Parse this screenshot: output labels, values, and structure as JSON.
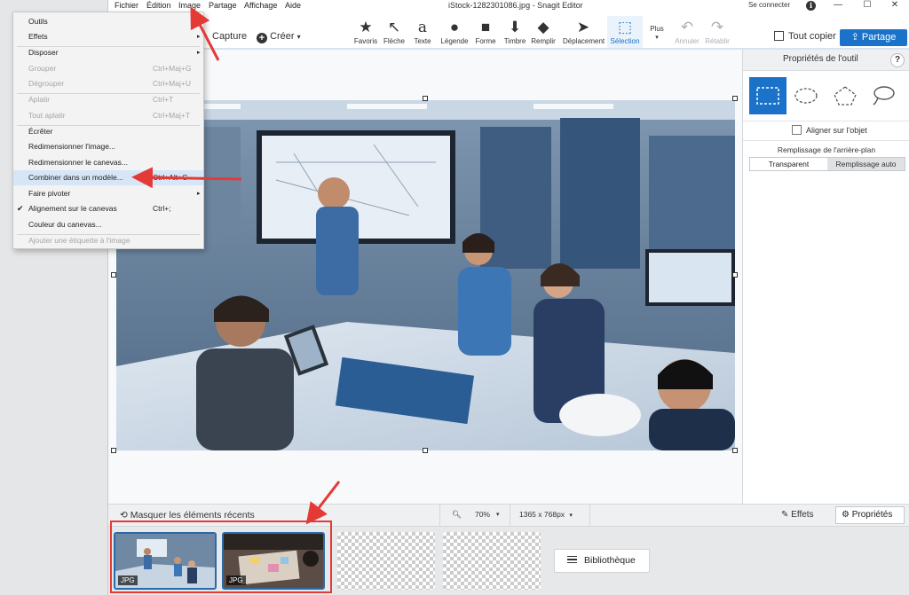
{
  "menubar": {
    "items": [
      "Fichier",
      "Édition",
      "Image",
      "Partage",
      "Affichage",
      "Aide"
    ],
    "window_title": "iStock-1282301086.jpg - Snagit Editor",
    "sign_in": "Se connecter",
    "info": "i",
    "min": "—",
    "max": "☐",
    "close": "✕"
  },
  "toolbar": {
    "capture": "Capture",
    "create": "Créer",
    "tools": [
      {
        "label": "Favoris",
        "icon": "★"
      },
      {
        "label": "Flèche",
        "icon": "↖"
      },
      {
        "label": "Texte",
        "icon": "a"
      },
      {
        "label": "Légende",
        "icon": "●"
      },
      {
        "label": "Forme",
        "icon": "■"
      },
      {
        "label": "Timbre",
        "icon": "⬇"
      },
      {
        "label": "Remplir",
        "icon": "◆"
      },
      {
        "label": "Déplacement",
        "icon": "➤"
      },
      {
        "label": "Sélection",
        "icon": "⬚"
      },
      {
        "label": "Plus",
        "icon": ""
      },
      {
        "label": "Annuler",
        "icon": "↶"
      },
      {
        "label": "Rétablir",
        "icon": "↷"
      }
    ],
    "copy_all": "Tout copier",
    "share": "Partage"
  },
  "dropdown": {
    "items": [
      {
        "label": "Outils",
        "shortcut": "",
        "disabled": false,
        "arrow": false
      },
      {
        "label": "Effets",
        "shortcut": "",
        "disabled": false,
        "arrow": true
      },
      {
        "label": "Disposer",
        "shortcut": "",
        "disabled": false,
        "arrow": true
      },
      {
        "label": "Grouper",
        "shortcut": "Ctrl+Maj+G",
        "disabled": true,
        "arrow": false
      },
      {
        "label": "Dégrouper",
        "shortcut": "Ctrl+Maj+U",
        "disabled": true,
        "arrow": false
      },
      {
        "label": "Aplatir",
        "shortcut": "Ctrl+T",
        "disabled": true,
        "arrow": false
      },
      {
        "label": "Tout aplatir",
        "shortcut": "Ctrl+Maj+T",
        "disabled": true,
        "arrow": false
      },
      {
        "label": "Écrêter",
        "shortcut": "",
        "disabled": false,
        "arrow": false
      },
      {
        "label": "Redimensionner l'image...",
        "shortcut": "",
        "disabled": false,
        "arrow": false
      },
      {
        "label": "Redimensionner le canevas...",
        "shortcut": "",
        "disabled": false,
        "arrow": false
      },
      {
        "label": "Combiner dans un modèle...",
        "shortcut": "Ctrl+Alt+C",
        "disabled": false,
        "arrow": false
      },
      {
        "label": "Faire pivoter",
        "shortcut": "",
        "disabled": false,
        "arrow": true
      },
      {
        "label": "Alignement sur le canevas",
        "shortcut": "Ctrl+;",
        "disabled": false,
        "arrow": false,
        "checked": true
      },
      {
        "label": "Couleur du canevas...",
        "shortcut": "",
        "disabled": false,
        "arrow": false
      },
      {
        "label": "Ajouter une étiquette à l'image",
        "shortcut": "",
        "disabled": true,
        "arrow": false
      }
    ],
    "check_glyph": "✔",
    "arrow_glyph": "▸"
  },
  "properties": {
    "title": "Propriétés de l'outil",
    "help": "?",
    "snap_label": "Aligner sur l'objet",
    "bg_fill_label": "Remplissage de l'arrière-plan",
    "bg_fill_options": [
      "Transparent",
      "Remplissage auto"
    ],
    "bg_fill_selected": "Transparent"
  },
  "status": {
    "hide_recent": "Masquer les éléments récents",
    "zoom": "70%",
    "size": "1365 x 768px",
    "effects": "Effets",
    "properties": "Propriétés"
  },
  "tray": {
    "thumbs": [
      {
        "type": "JPG"
      },
      {
        "type": "JPG"
      }
    ],
    "library": "Bibliothèque"
  },
  "colors": {
    "accent": "#1a73c8",
    "annotation": "#e53935"
  }
}
